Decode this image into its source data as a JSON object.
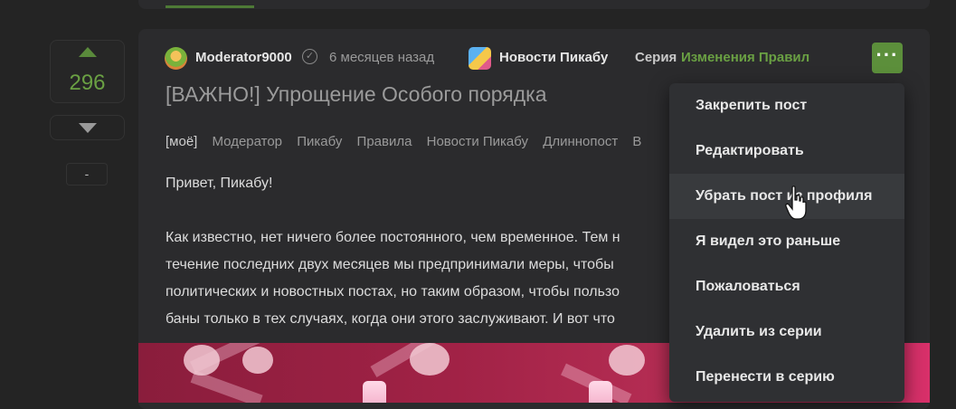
{
  "vote": {
    "count": "296",
    "minus_label": "-"
  },
  "post": {
    "author": "Moderator9000",
    "time": "6 месяцев назад",
    "community": "Новости Пикабу",
    "series_label": "Серия",
    "series_name": "Изменения Правил",
    "more_label": "···",
    "title": "[ВАЖНО!] Упрощение Особого порядка",
    "tags": [
      "[моё]",
      "Модератор",
      "Пикабу",
      "Правила",
      "Новости Пикабу",
      "Длиннопост",
      "В"
    ],
    "body": [
      "Привет, Пикабу!",
      "Как известно, нет ничего более постоянного, чем временное. Тем н",
      "течение последних двух месяцев мы предпринимали меры, чтобы",
      "политических и новостных постах, но таким образом, чтобы пользо",
      "баны только в тех случаях, когда они этого заслуживают. И вот что"
    ]
  },
  "menu": {
    "items": [
      "Закрепить пост",
      "Редактировать",
      "Убрать пост из профиля",
      "Я видел это раньше",
      "Пожаловаться",
      "Удалить из серии",
      "Перенести в серию"
    ],
    "hovered_index": 2
  },
  "colors": {
    "accent": "#5c8f3b",
    "background": "#242424",
    "card": "#2b2b2d"
  },
  "icons": [
    "vote-up-icon",
    "vote-down-icon",
    "verified-icon",
    "more-icon",
    "hand-cursor-icon"
  ]
}
